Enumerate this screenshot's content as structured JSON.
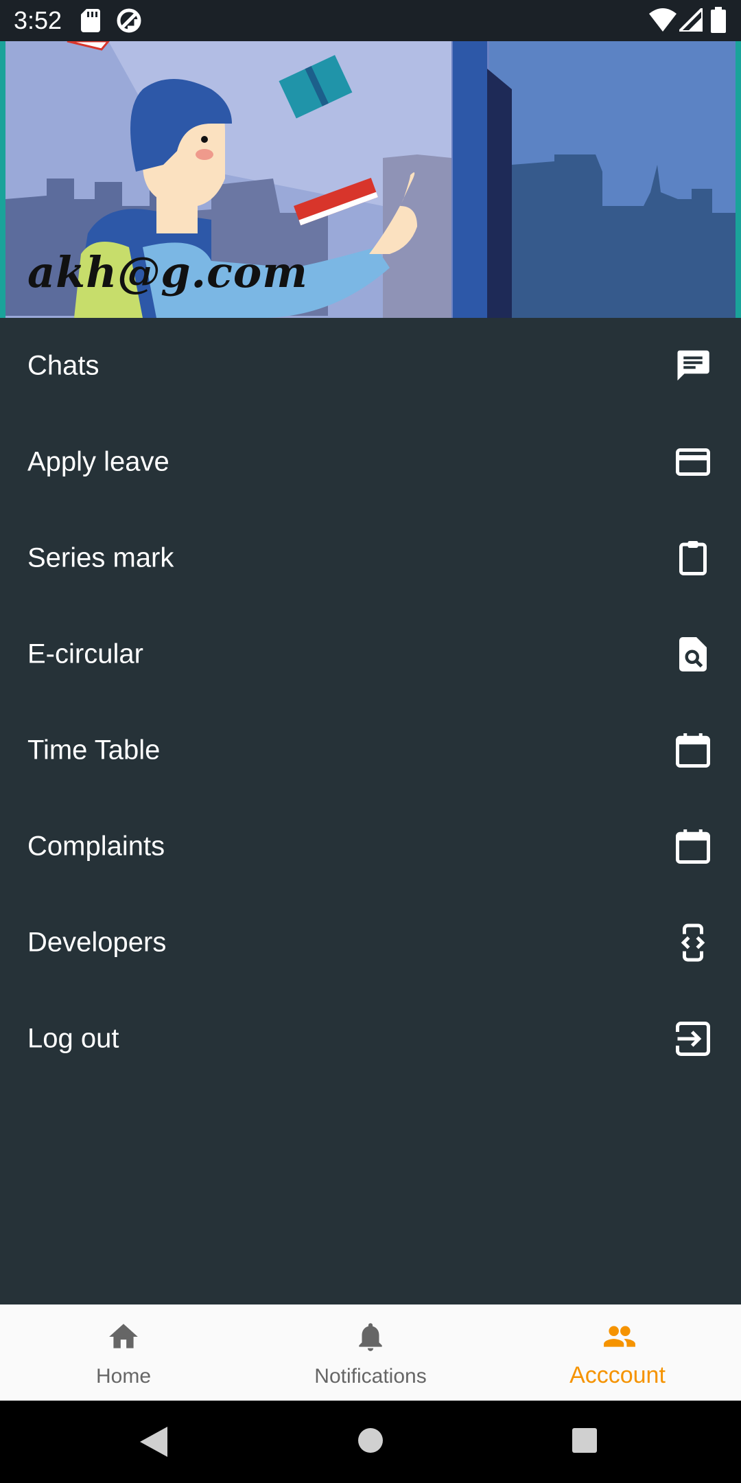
{
  "status_bar": {
    "time": "3:52",
    "icons": [
      "sd-card-icon",
      "sync-icon",
      "wifi-icon",
      "signal-icon",
      "battery-icon"
    ]
  },
  "header": {
    "email": "akh@g.com"
  },
  "menu": {
    "items": [
      {
        "label": "Chats",
        "icon": "chat-icon"
      },
      {
        "label": "Apply leave",
        "icon": "credit-card-icon"
      },
      {
        "label": "Series mark",
        "icon": "clipboard-icon"
      },
      {
        "label": "E-circular",
        "icon": "find-in-page-icon"
      },
      {
        "label": "Time Table",
        "icon": "calendar-icon"
      },
      {
        "label": "Complaints",
        "icon": "calendar-icon"
      },
      {
        "label": "Developers",
        "icon": "developer-mode-icon"
      },
      {
        "label": "Log out",
        "icon": "exit-icon"
      }
    ]
  },
  "bottom_nav": {
    "items": [
      {
        "label": "Home",
        "icon": "home-icon",
        "active": false
      },
      {
        "label": "Notifications",
        "icon": "bell-icon",
        "active": false
      },
      {
        "label": "Acccount",
        "icon": "people-icon",
        "active": true
      }
    ]
  },
  "colors": {
    "background": "#263238",
    "accent": "#f59300",
    "nav_background": "#fafafa",
    "header_border": "#1aa39a"
  }
}
